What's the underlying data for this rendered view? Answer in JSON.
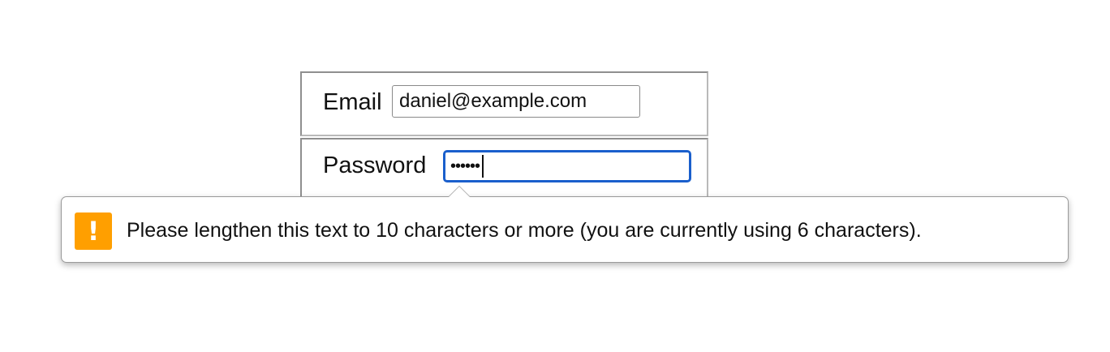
{
  "form": {
    "email": {
      "label": "Email",
      "value": "daniel@example.com"
    },
    "password": {
      "label": "Password",
      "masked_value": "••••••"
    }
  },
  "validation_tooltip": {
    "icon": "warning-icon",
    "icon_glyph": "!",
    "icon_color": "#ff9f00",
    "message": "Please lengthen this text to 10 characters or more (you are currently using 6 characters)."
  },
  "colors": {
    "focus_ring": "#1a5fcc"
  }
}
